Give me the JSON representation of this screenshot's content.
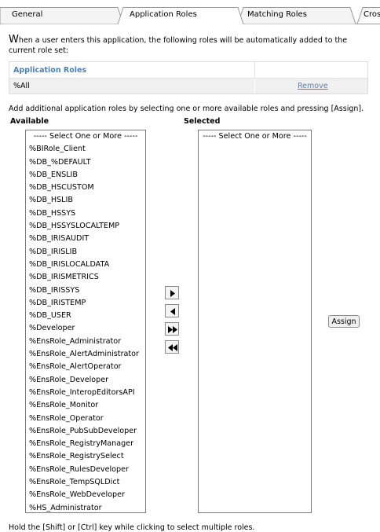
{
  "tabs": [
    {
      "label": "General"
    },
    {
      "label": "Application Roles"
    },
    {
      "label": "Matching Roles"
    },
    {
      "label": "Cros"
    }
  ],
  "intro": {
    "first_letter": "W",
    "text": "hen a user enters this application, the following roles will be automatically added to the current role set:"
  },
  "roles_table": {
    "header": "Application Roles",
    "rows": [
      {
        "name": "%All",
        "action": "Remove"
      }
    ]
  },
  "assign_instructions": "Add additional application roles by selecting one or more available roles and pressing [Assign].",
  "available": {
    "label": "Available",
    "placeholder": "----- Select One or More -----",
    "options": [
      "%BIRole_Client",
      "%DB_%DEFAULT",
      "%DB_ENSLIB",
      "%DB_HSCUSTOM",
      "%DB_HSLIB",
      "%DB_HSSYS",
      "%DB_HSSYSLOCALTEMP",
      "%DB_IRISAUDIT",
      "%DB_IRISLIB",
      "%DB_IRISLOCALDATA",
      "%DB_IRISMETRICS",
      "%DB_IRISSYS",
      "%DB_IRISTEMP",
      "%DB_USER",
      "%Developer",
      "%EnsRole_Administrator",
      "%EnsRole_AlertAdministrator",
      "%EnsRole_AlertOperator",
      "%EnsRole_Developer",
      "%EnsRole_InteropEditorsAPI",
      "%EnsRole_Monitor",
      "%EnsRole_Operator",
      "%EnsRole_PubSubDeveloper",
      "%EnsRole_RegistryManager",
      "%EnsRole_RegistrySelect",
      "%EnsRole_RulesDeveloper",
      "%EnsRole_TempSQLDict",
      "%EnsRole_WebDeveloper",
      "%HS_Administrator"
    ]
  },
  "selected": {
    "label": "Selected",
    "placeholder": "----- Select One or More -----"
  },
  "move_buttons": [
    {
      "icon": "arrow-right-icon"
    },
    {
      "icon": "arrow-left-icon"
    },
    {
      "icon": "double-arrow-right-icon"
    },
    {
      "icon": "double-arrow-left-icon"
    }
  ],
  "assign_label": "Assign",
  "footer_note": "Hold the [Shift] or [Ctrl] key while clicking to select multiple roles."
}
